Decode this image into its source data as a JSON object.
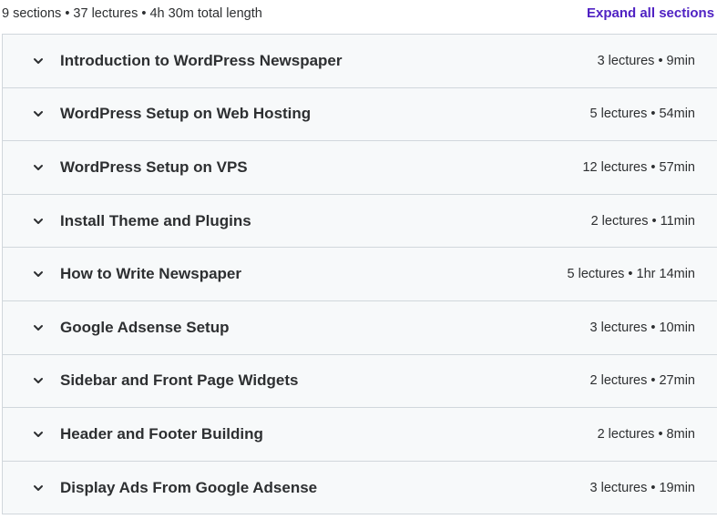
{
  "summary": {
    "text": "9 sections • 37 lectures • 4h 30m total length",
    "expand_label": "Expand all sections"
  },
  "icons": {
    "section_toggle": "chevron-down-icon"
  },
  "colors": {
    "accent": "#5022c3",
    "row_background": "#f7f9fa",
    "border": "#d1d7dc",
    "text": "#2d2f31"
  },
  "sections": [
    {
      "title": "Introduction to WordPress Newspaper",
      "meta": "3 lectures • 9min"
    },
    {
      "title": "WordPress Setup on Web Hosting",
      "meta": "5 lectures • 54min"
    },
    {
      "title": "WordPress Setup on VPS",
      "meta": "12 lectures • 57min"
    },
    {
      "title": "Install Theme and Plugins",
      "meta": "2 lectures • 11min"
    },
    {
      "title": "How to Write Newspaper",
      "meta": "5 lectures • 1hr 14min"
    },
    {
      "title": "Google Adsense Setup",
      "meta": "3 lectures • 10min"
    },
    {
      "title": "Sidebar and Front Page Widgets",
      "meta": "2 lectures • 27min"
    },
    {
      "title": "Header and Footer Building",
      "meta": "2 lectures • 8min"
    },
    {
      "title": "Display Ads From Google Adsense",
      "meta": "3 lectures • 19min"
    }
  ]
}
